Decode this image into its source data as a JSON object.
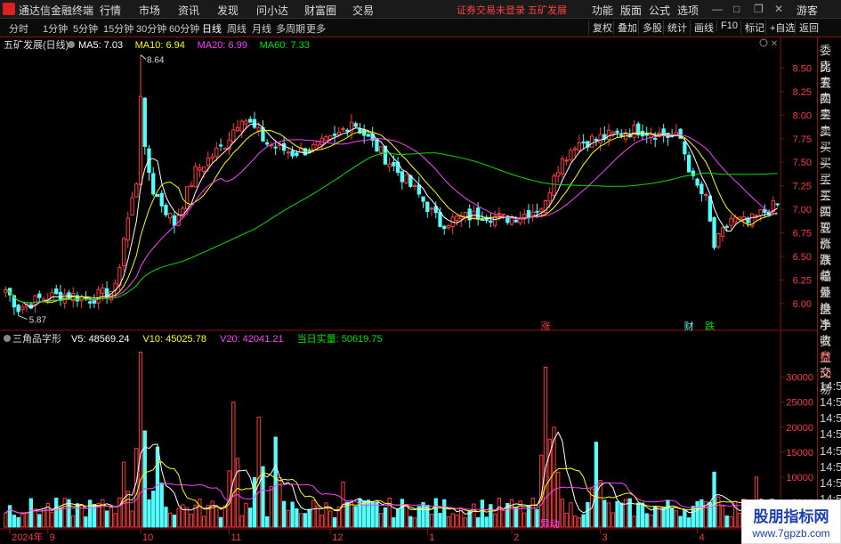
{
  "app": {
    "title": "通达信金融终端"
  },
  "menu": [
    "行情",
    "市场",
    "资讯",
    "发现",
    "问小达",
    "财富圈",
    "交易"
  ],
  "notice": "证券交易未登录  五矿发展",
  "window_buttons": [
    "功能",
    "版面",
    "公式",
    "选项"
  ],
  "guest": "游客",
  "period_tabs": [
    {
      "label": "分时",
      "active": false
    },
    {
      "label": "1分钟",
      "active": false
    },
    {
      "label": "5分钟",
      "active": false
    },
    {
      "label": "15分钟",
      "active": false
    },
    {
      "label": "30分钟",
      "active": false
    },
    {
      "label": "60分钟",
      "active": false
    },
    {
      "label": "日线",
      "active": true
    },
    {
      "label": "周线",
      "active": false
    },
    {
      "label": "月线",
      "active": false
    },
    {
      "label": "多周期",
      "active": false
    },
    {
      "label": "更多",
      "active": false
    }
  ],
  "toolbar_right": [
    "复权",
    "叠加",
    "多股",
    "统计",
    "画线",
    "F10",
    "标记",
    "+自选",
    "返回"
  ],
  "sidebar": [
    "委比",
    "卖五",
    "卖四",
    "卖三",
    "卖二",
    "卖一",
    "买一",
    "买二",
    "买三",
    "买四",
    "买五",
    "现价",
    "涨跌",
    "涨幅",
    "总量",
    "外盘",
    "换手",
    "净资",
    "收益",
    "自动",
    "交易",
    "14:56",
    "14:56",
    "14:56",
    "14:56",
    "14:56",
    "14:56",
    "14:56",
    "14:56",
    "14:56",
    "14:56"
  ],
  "brand": {
    "name": "股朋指标网",
    "url": "www.7gpzb.com"
  },
  "colors": {
    "up": "#ff3b3b",
    "down": "#54fcfc",
    "ma5": "#ffffff",
    "ma10": "#ffff00",
    "ma20": "#ff40ff",
    "ma60": "#00e000",
    "v5": "#ffffff",
    "v10": "#ffff00",
    "v20": "#ff40ff",
    "realvol": "#00e000",
    "grid": "#8b1010"
  },
  "chart_data": [
    {
      "type": "candlestick",
      "title": "五矿发展(日线)",
      "indicators": [
        {
          "name": "MA5",
          "label": "MA5: 7.03"
        },
        {
          "name": "MA10",
          "label": "MA10: 6.94"
        },
        {
          "name": "MA20",
          "label": "MA20: 6.99"
        },
        {
          "name": "MA60",
          "label": "MA60: 7.33"
        }
      ],
      "ylim": [
        5.8,
        8.75
      ],
      "y_ticks": [
        "8.50",
        "8.25",
        "8.00",
        "7.75",
        "7.50",
        "7.25",
        "7.00",
        "6.75",
        "6.50",
        "6.25",
        "6.00"
      ],
      "y_tick_values": [
        8.5,
        8.25,
        8.0,
        7.75,
        7.5,
        7.25,
        7.0,
        6.75,
        6.5,
        6.25,
        6.0
      ],
      "annotations": [
        {
          "text": "8.64",
          "value": 8.64,
          "bar": 32
        },
        {
          "text": "5.87",
          "value": 5.87,
          "bar": 3
        }
      ],
      "event_markers": [
        {
          "text": "涨",
          "bar": 128,
          "color": "#ff3b3b"
        },
        {
          "text": "财",
          "bar": 162,
          "color": "#54fcfc"
        },
        {
          "text": "跌",
          "bar": 167,
          "color": "#00e000"
        }
      ],
      "anchors": [
        [
          0,
          6.15
        ],
        [
          3,
          5.95
        ],
        [
          8,
          6.05
        ],
        [
          14,
          6.1
        ],
        [
          20,
          6.05
        ],
        [
          26,
          6.15
        ],
        [
          28,
          6.7
        ],
        [
          31,
          7.3
        ],
        [
          32,
          8.2
        ],
        [
          33,
          7.6
        ],
        [
          35,
          7.2
        ],
        [
          40,
          6.85
        ],
        [
          45,
          7.4
        ],
        [
          52,
          7.7
        ],
        [
          56,
          8.0
        ],
        [
          62,
          7.7
        ],
        [
          68,
          7.6
        ],
        [
          73,
          7.65
        ],
        [
          78,
          7.75
        ],
        [
          82,
          7.95
        ],
        [
          87,
          7.7
        ],
        [
          92,
          7.45
        ],
        [
          98,
          7.15
        ],
        [
          103,
          6.85
        ],
        [
          107,
          6.9
        ],
        [
          113,
          6.95
        ],
        [
          118,
          6.9
        ],
        [
          123,
          6.95
        ],
        [
          128,
          7.05
        ],
        [
          130,
          7.4
        ],
        [
          135,
          7.7
        ],
        [
          140,
          7.75
        ],
        [
          145,
          7.8
        ],
        [
          150,
          7.85
        ],
        [
          155,
          7.8
        ],
        [
          160,
          7.75
        ],
        [
          163,
          7.3
        ],
        [
          166,
          7.1
        ],
        [
          168,
          6.6
        ],
        [
          172,
          6.9
        ],
        [
          176,
          6.85
        ],
        [
          179,
          6.95
        ],
        [
          183,
          7.05
        ]
      ],
      "n_bars": 184
    },
    {
      "type": "bar",
      "title": "三角品字形",
      "indicators": [
        {
          "name": "V5",
          "label": "V5: 48569.24"
        },
        {
          "name": "V10",
          "label": "V10: 45025.78"
        },
        {
          "name": "V20",
          "label": "V20: 42041.21"
        },
        {
          "name": "当日实量",
          "label": "当日实量: 50619.75"
        }
      ],
      "ylim": [
        0,
        36000
      ],
      "y_ticks": [
        "30000",
        "25000",
        "20000",
        "15000",
        "10000",
        "5000"
      ],
      "y_tick_values": [
        30000,
        25000,
        20000,
        15000,
        10000,
        5000
      ],
      "spikes": [
        [
          32,
          35000
        ],
        [
          28,
          13000
        ],
        [
          36,
          16000
        ],
        [
          54,
          25000
        ],
        [
          60,
          22000
        ],
        [
          64,
          18000
        ],
        [
          80,
          9000
        ],
        [
          128,
          32000
        ],
        [
          130,
          20000
        ],
        [
          140,
          17000
        ],
        [
          168,
          11000
        ],
        [
          178,
          10000
        ]
      ],
      "baseline_volume": 4500,
      "marker": {
        "text": "异动",
        "bar": 129
      }
    }
  ],
  "x_axis_labels": [
    {
      "text": "2024年",
      "bar": 1
    },
    {
      "text": "9",
      "bar": 10
    },
    {
      "text": "10",
      "bar": 32
    },
    {
      "text": "11",
      "bar": 53
    },
    {
      "text": "12",
      "bar": 77
    },
    {
      "text": "1",
      "bar": 100
    },
    {
      "text": "2",
      "bar": 120
    },
    {
      "text": "3",
      "bar": 141
    },
    {
      "text": "4",
      "bar": 164
    }
  ]
}
